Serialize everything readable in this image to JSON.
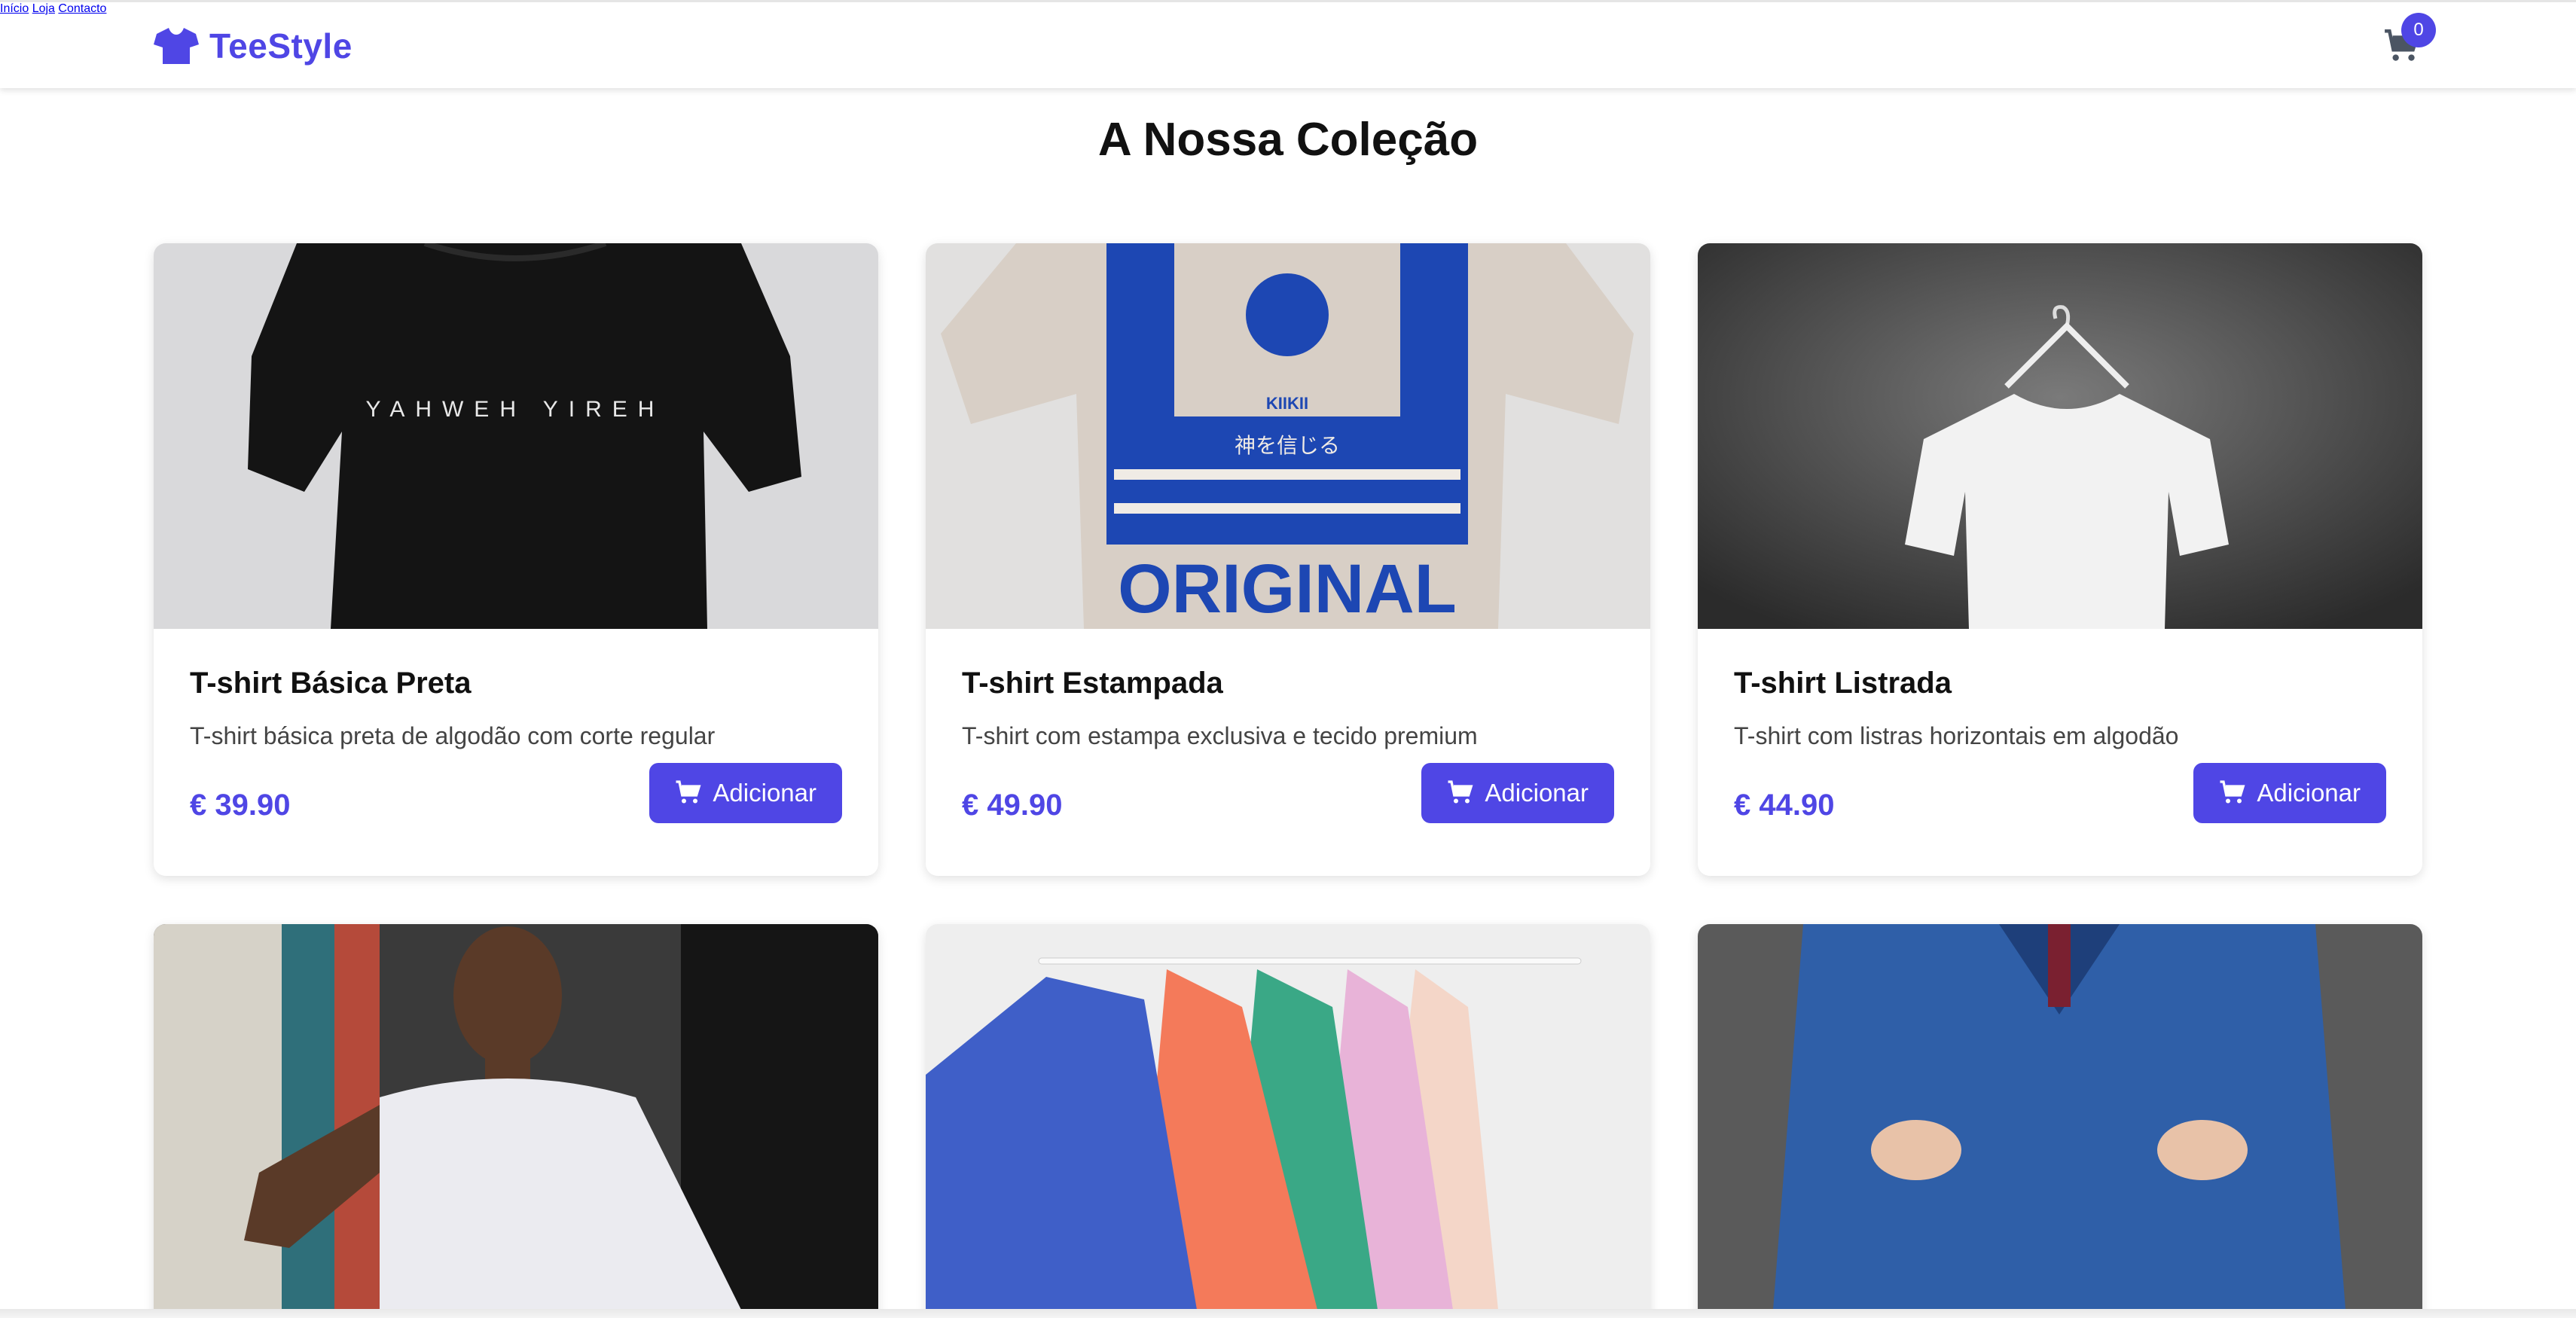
{
  "brand": {
    "name": "TeeStyle",
    "color": "#4f46e5",
    "logo_icon": "tshirt-icon"
  },
  "nav": {
    "items": [
      "Início",
      "Loja",
      "Contacto"
    ]
  },
  "cart": {
    "icon": "cart-icon",
    "count": "0"
  },
  "page": {
    "title": "A Nossa Coleção"
  },
  "products": [
    {
      "name": "T-shirt Básica Preta",
      "description": "T-shirt básica preta de algodão com corte regular",
      "price": "€ 39.90",
      "button": "Adicionar"
    },
    {
      "name": "T-shirt Estampada",
      "description": "T-shirt com estampa exclusiva e tecido premium",
      "price": "€ 49.90",
      "button": "Adicionar"
    },
    {
      "name": "T-shirt Listrada",
      "description": "T-shirt com listras horizontais em algodão",
      "price": "€ 44.90",
      "button": "Adicionar"
    }
  ],
  "images": {
    "black_tee_print": "YAHWEH YIREH",
    "graphic_tee_brand": "KIIKII",
    "graphic_tee_japanese": "神を信じる",
    "graphic_tee_word": "ORIGINAL"
  }
}
